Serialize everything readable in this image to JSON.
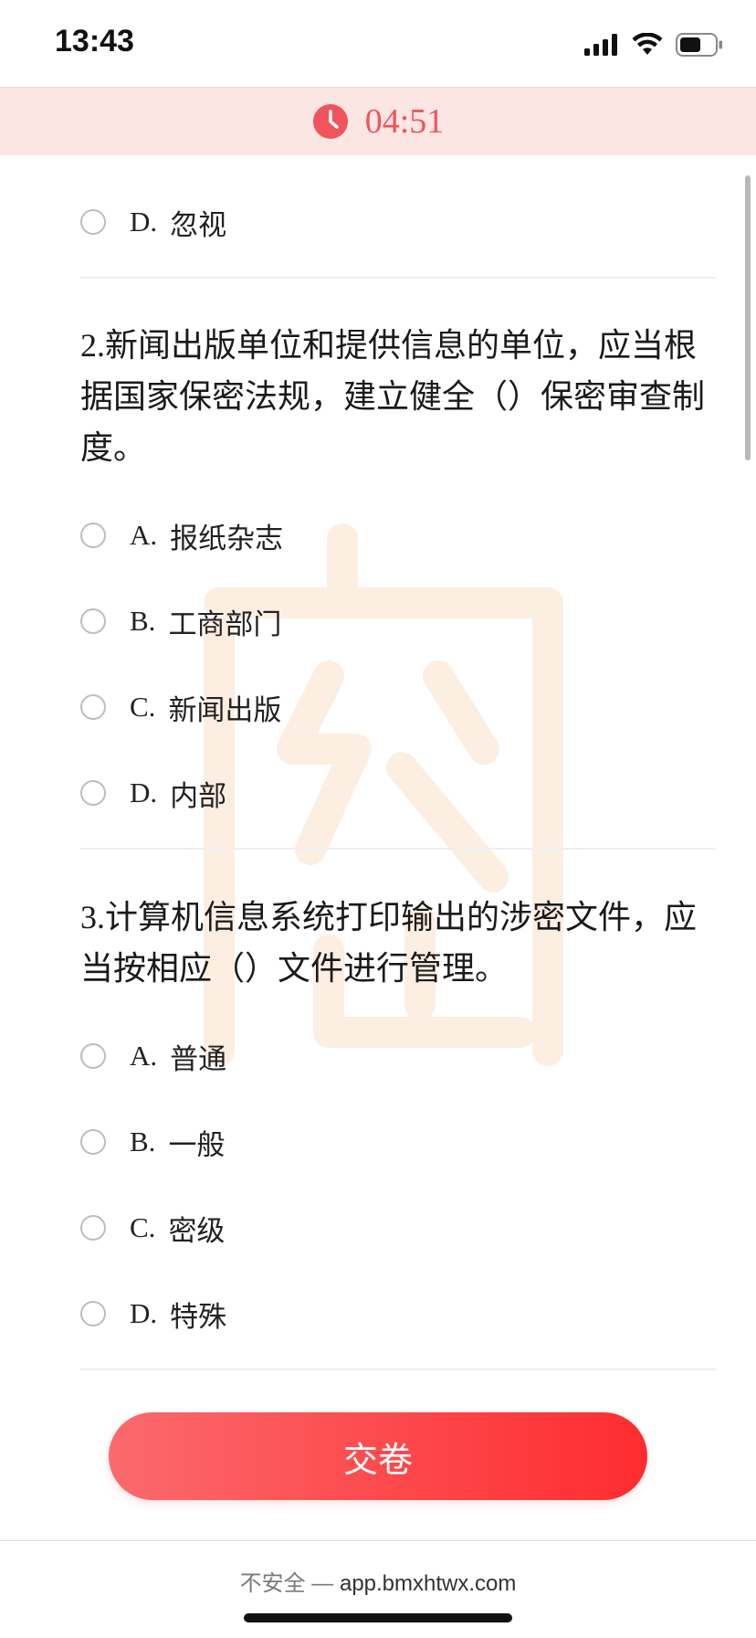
{
  "status_bar": {
    "time": "13:43"
  },
  "timer": {
    "value": "04:51",
    "accent_color": "#f0545c"
  },
  "previous_question_tail": {
    "options": [
      {
        "letter": "D.",
        "text": "忽视"
      }
    ]
  },
  "questions": [
    {
      "number": "2.",
      "text": "新闻出版单位和提供信息的单位，应当根据国家保密法规，建立健全（）保密审查制度。",
      "options": [
        {
          "letter": "A.",
          "text": "报纸杂志"
        },
        {
          "letter": "B.",
          "text": "工商部门"
        },
        {
          "letter": "C.",
          "text": "新闻出版"
        },
        {
          "letter": "D.",
          "text": "内部"
        }
      ]
    },
    {
      "number": "3.",
      "text": "计算机信息系统打印输出的涉密文件，应当按相应（）文件进行管理。",
      "options": [
        {
          "letter": "A.",
          "text": "普通"
        },
        {
          "letter": "B.",
          "text": "一般"
        },
        {
          "letter": "C.",
          "text": "密级"
        },
        {
          "letter": "D.",
          "text": "特殊"
        }
      ]
    }
  ],
  "submit": {
    "label": "交卷",
    "gradient_start": "#fb6a6e",
    "gradient_end": "#fe2c2f"
  },
  "browser": {
    "security_label": "不安全 —",
    "domain": "app.bmxhtwx.com"
  }
}
